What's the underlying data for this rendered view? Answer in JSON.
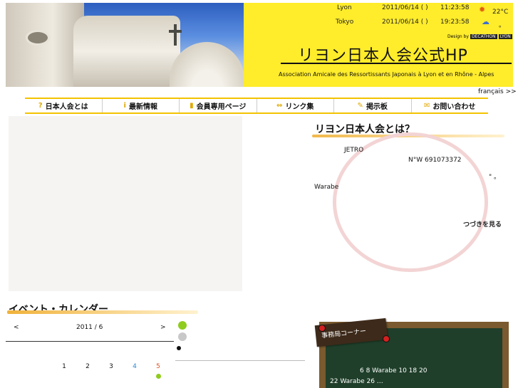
{
  "clocks": [
    {
      "city": "Lyon",
      "date": "2011/06/14 ( )",
      "time": "11:23:58",
      "temp": "22°C"
    },
    {
      "city": "Tokyo",
      "date": "2011/06/14 ( )",
      "time": "19:23:58",
      "temp": "。"
    }
  ],
  "header": {
    "designby_label": "Design by",
    "designby_brand1": "DECATHON",
    "designby_brand2": "LYON",
    "title": "リヨン日本人会公式HP",
    "subtitle": "Association Amicale des Ressortissants Japonais à Lyon et en Rhône - Alpes"
  },
  "lang_link": "français >>",
  "nav": [
    {
      "icon": "?",
      "label": "日本人会とは"
    },
    {
      "icon": "i",
      "label": "最新情報"
    },
    {
      "icon": "▮",
      "label": "会員専用ページ"
    },
    {
      "icon": "⇔",
      "label": "リンク集"
    },
    {
      "icon": "✎",
      "label": "掲示板"
    },
    {
      "icon": "✉",
      "label": "お問い合わせ"
    }
  ],
  "about": {
    "title": "リヨン日本人会とは？",
    "jetro": "JETRO",
    "siret": "N°W 691073372",
    "quote": "\" 。",
    "warabe": "Warabe",
    "more": "つづきを見る"
  },
  "calendar": {
    "title": "イベント・カレンダー",
    "prev": "<",
    "month": "2011 / 6",
    "next": ">",
    "days": [
      "1",
      "2",
      "3",
      "4",
      "5"
    ]
  },
  "board": {
    "tag": "事務局コーナー",
    "line1": "6 8   Warabe 10       18       20",
    "line2": "22     Warabe 26          …"
  }
}
